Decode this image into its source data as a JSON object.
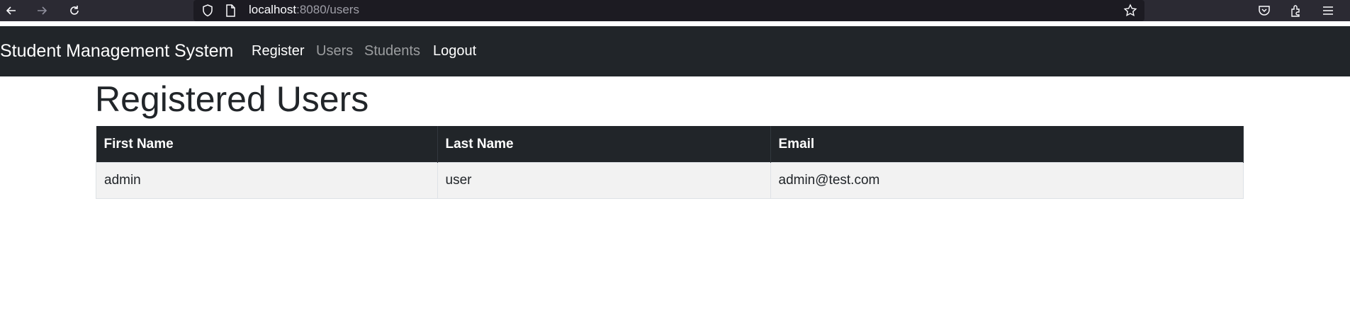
{
  "browser": {
    "url_host": "localhost",
    "url_path": ":8080/users"
  },
  "navbar": {
    "brand": "Student Management System",
    "links": [
      {
        "label": "Register",
        "state": "active"
      },
      {
        "label": "Users",
        "state": "muted"
      },
      {
        "label": "Students",
        "state": "muted"
      },
      {
        "label": "Logout",
        "state": "active"
      }
    ]
  },
  "page": {
    "title": "Registered Users"
  },
  "table": {
    "headers": [
      "First Name",
      "Last Name",
      "Email"
    ],
    "rows": [
      [
        "admin",
        "user",
        "admin@test.com"
      ]
    ]
  },
  "colors": {
    "navbar_bg": "#212529",
    "browser_bg": "#2b2a33",
    "row_bg": "#f2f2f2"
  }
}
